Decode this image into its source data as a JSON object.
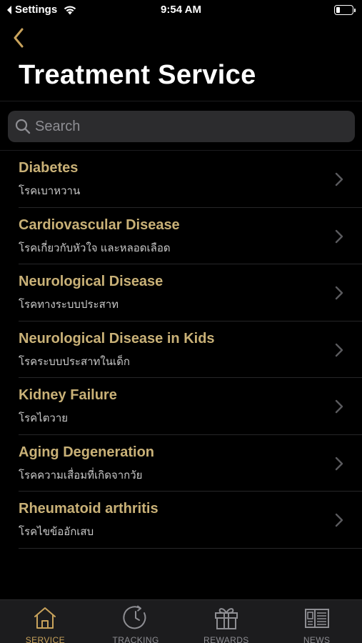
{
  "status_bar": {
    "back_app": "Settings",
    "time": "9:54 AM",
    "battery_level": 0.25
  },
  "header": {
    "back_icon": "chevron-left-icon",
    "title": "Treatment Service"
  },
  "search": {
    "icon": "search-icon",
    "placeholder": "Search",
    "value": ""
  },
  "services": [
    {
      "title": "Diabetes",
      "subtitle": "โรคเบาหวาน"
    },
    {
      "title": "Cardiovascular Disease",
      "subtitle": "โรคเกี่ยวกับหัวใจ และหลอดเลือด"
    },
    {
      "title": "Neurological Disease",
      "subtitle": "โรคทางระบบประสาท"
    },
    {
      "title": "Neurological Disease in Kids",
      "subtitle": "โรคระบบประสาทในเด็ก"
    },
    {
      "title": "Kidney Failure",
      "subtitle": "โรคไตวาย"
    },
    {
      "title": "Aging Degeneration",
      "subtitle": "โรคความเสื่อมที่เกิดจากวัย"
    },
    {
      "title": "Rheumatoid arthritis",
      "subtitle": "โรคไขข้ออักเสบ"
    }
  ],
  "tab_bar": {
    "active": "service",
    "tabs": [
      {
        "id": "service",
        "label": "SERVICE",
        "icon": "home-icon"
      },
      {
        "id": "tracking",
        "label": "TRACKING",
        "icon": "clock-icon"
      },
      {
        "id": "rewards",
        "label": "REWARDS",
        "icon": "gift-icon"
      },
      {
        "id": "news",
        "label": "NEWS",
        "icon": "newspaper-icon"
      }
    ]
  },
  "colors": {
    "accent": "#c9a35c",
    "item_title": "#c9b177",
    "background": "#000000",
    "tab_inactive": "#8e8e93"
  }
}
